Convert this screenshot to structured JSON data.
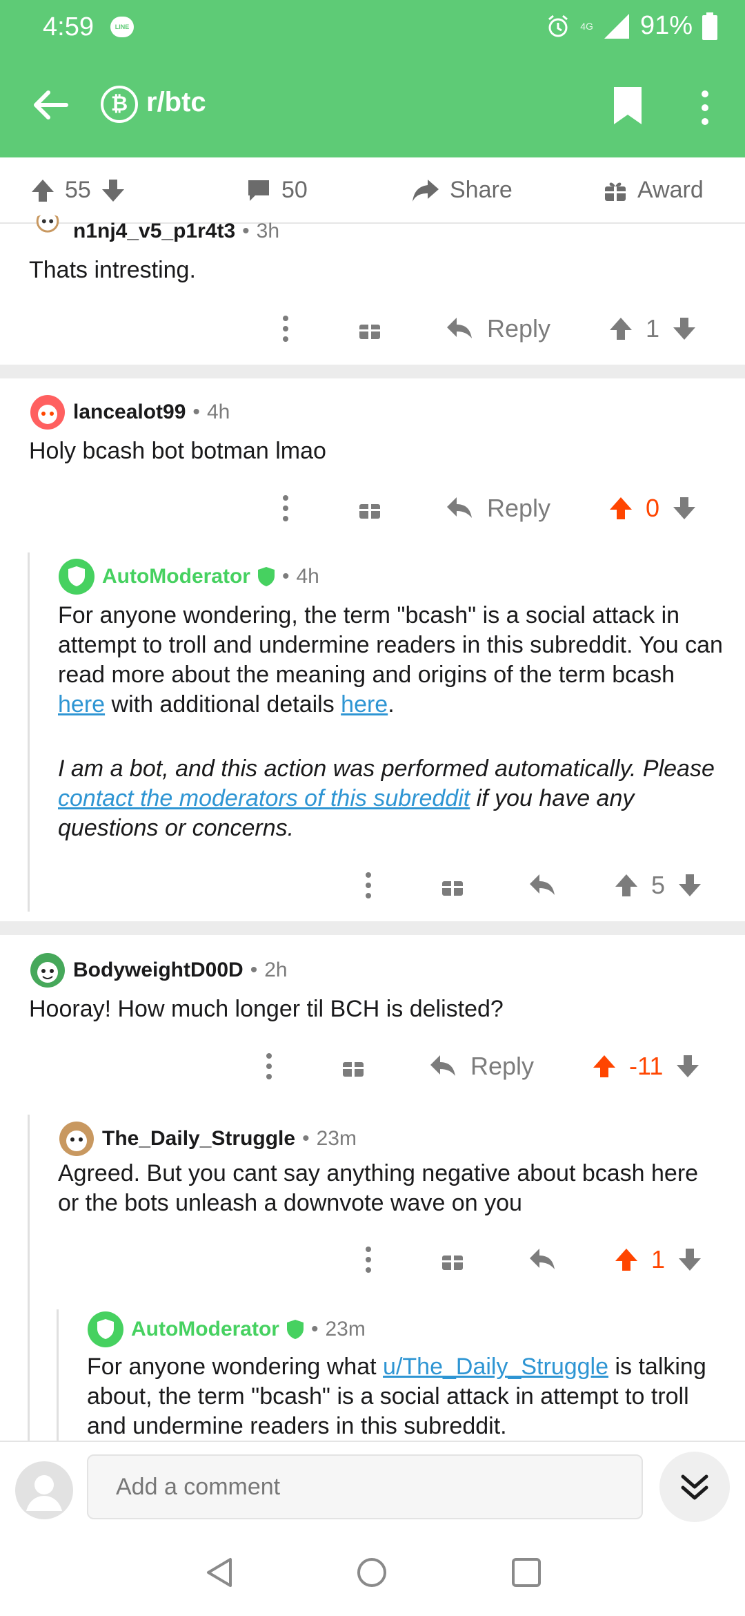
{
  "status_bar": {
    "time": "4:59",
    "app_badge": "LINE",
    "network": "4G",
    "battery": "91%"
  },
  "app_bar": {
    "subreddit": "r/btc",
    "subreddit_icon": "bitcoin-icon"
  },
  "post_actions": {
    "upvotes": "55",
    "comments": "50",
    "share_label": "Share",
    "award_label": "Award"
  },
  "comments": [
    {
      "author": "n1nj4_v5_p1r4t3",
      "age": "3h",
      "text": "Thats intresting.",
      "reply_label": "Reply",
      "score": "1"
    },
    {
      "author": "lancealot99",
      "age": "4h",
      "text": "Holy bcash bot botman lmao",
      "reply_label": "Reply",
      "score": "0"
    },
    {
      "author": "AutoModerator",
      "age": "4h",
      "p1_a": "For anyone wondering, the term \"bcash\" is a social attack in attempt to troll and undermine readers in this subreddit. You can read more about the meaning and origins of the term bcash ",
      "link1": "here",
      "p1_b": " with additional details ",
      "link2": "here",
      "p1_c": ".",
      "p2_a": "I am a bot, and this action was performed automatically. Please ",
      "link3": "contact the moderators of this subreddit",
      "p2_b": " if you have any questions or concerns.",
      "score": "5"
    },
    {
      "author": "BodyweightD00D",
      "age": "2h",
      "text": "Hooray! How much longer til BCH is delisted?",
      "reply_label": "Reply",
      "score": "-11"
    },
    {
      "author": "The_Daily_Struggle",
      "age": "23m",
      "text": "Agreed. But you cant say anything negative about bcash here or the bots unleash a downvote wave on you",
      "score": "1"
    },
    {
      "author": "AutoModerator",
      "age": "23m",
      "p1_a": "For anyone wondering what ",
      "link1": "u/The_Daily_Struggle",
      "p1_b": " is talking about, the term \"bcash\" is a social attack in attempt to troll and undermine readers in this subreddit."
    }
  ],
  "composer": {
    "placeholder": "Add a comment"
  },
  "colors": {
    "brand_green": "#5ecb76",
    "upvote_orange": "#ff4500",
    "link_blue": "#2e95d3"
  }
}
